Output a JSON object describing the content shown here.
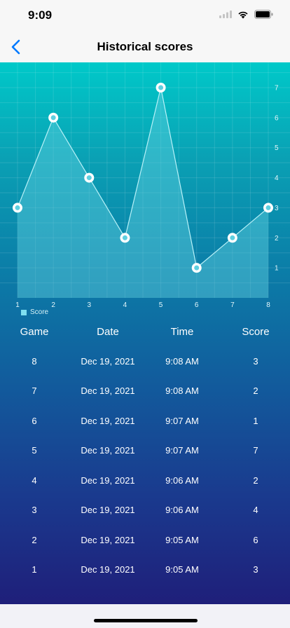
{
  "status_bar": {
    "time": "9:09"
  },
  "nav": {
    "title": "Historical scores"
  },
  "chart_data": {
    "type": "area",
    "x": [
      1,
      2,
      3,
      4,
      5,
      6,
      7,
      8
    ],
    "series": [
      {
        "name": "Score",
        "values": [
          3,
          6,
          4,
          2,
          7,
          1,
          2,
          3
        ]
      }
    ],
    "xlabel": "",
    "ylabel": "",
    "xlim": [
      1,
      8
    ],
    "ylim": [
      0,
      7
    ],
    "x_ticks": [
      "1",
      "2",
      "3",
      "4",
      "5",
      "6",
      "7",
      "8"
    ],
    "y_ticks": [
      "1",
      "2",
      "3",
      "4",
      "5",
      "6",
      "7"
    ],
    "y_axis_side": "right",
    "grid": true,
    "legend": "bottom-left",
    "colors": {
      "fill": "#5fd0e0",
      "line": "#b8f1f8",
      "point": "#ffffff"
    }
  },
  "table": {
    "headers": {
      "game": "Game",
      "date": "Date",
      "time": "Time",
      "score": "Score"
    },
    "rows": [
      {
        "game": "8",
        "date": "Dec 19, 2021",
        "time": "9:08 AM",
        "score": "3"
      },
      {
        "game": "7",
        "date": "Dec 19, 2021",
        "time": "9:08 AM",
        "score": "2"
      },
      {
        "game": "6",
        "date": "Dec 19, 2021",
        "time": "9:07 AM",
        "score": "1"
      },
      {
        "game": "5",
        "date": "Dec 19, 2021",
        "time": "9:07 AM",
        "score": "7"
      },
      {
        "game": "4",
        "date": "Dec 19, 2021",
        "time": "9:06 AM",
        "score": "2"
      },
      {
        "game": "3",
        "date": "Dec 19, 2021",
        "time": "9:06 AM",
        "score": "4"
      },
      {
        "game": "2",
        "date": "Dec 19, 2021",
        "time": "9:05 AM",
        "score": "6"
      },
      {
        "game": "1",
        "date": "Dec 19, 2021",
        "time": "9:05 AM",
        "score": "3"
      }
    ]
  },
  "colors": {
    "accent": "#007aff",
    "gradient_top": "#00c9c9",
    "gradient_bottom": "#1f1f7a"
  },
  "icons": {
    "back": "chevron-left-icon",
    "signal": "cellular-signal-icon",
    "wifi": "wifi-icon",
    "battery": "battery-icon"
  }
}
